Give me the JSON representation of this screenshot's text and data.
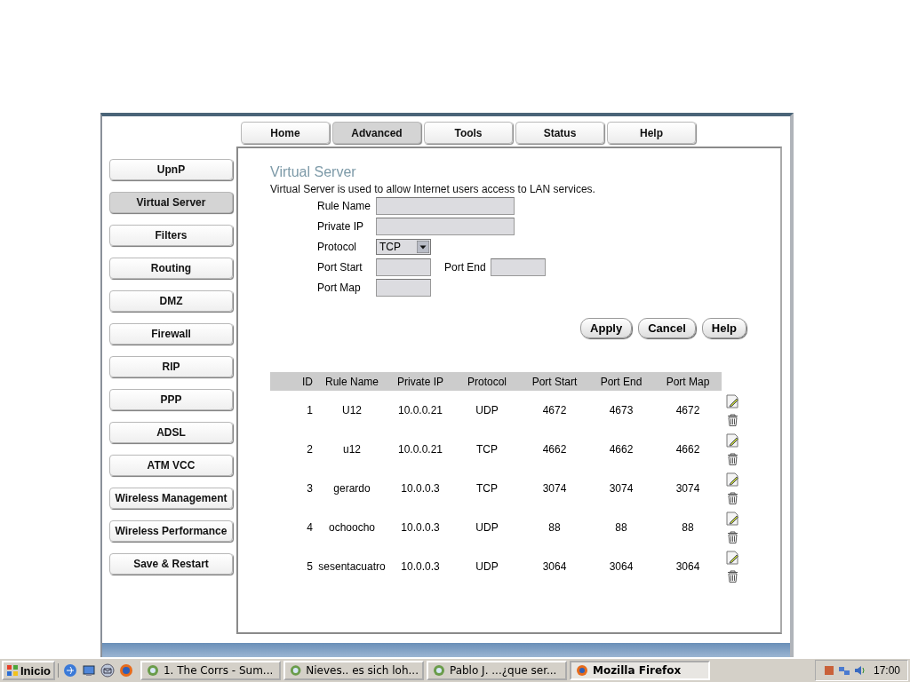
{
  "top_tabs": [
    {
      "label": "Home",
      "selected": false
    },
    {
      "label": "Advanced",
      "selected": true
    },
    {
      "label": "Tools",
      "selected": false
    },
    {
      "label": "Status",
      "selected": false
    },
    {
      "label": "Help",
      "selected": false
    }
  ],
  "sidebar": {
    "items": [
      {
        "label": "UpnP",
        "selected": false
      },
      {
        "label": "Virtual Server",
        "selected": true
      },
      {
        "label": "Filters",
        "selected": false
      },
      {
        "label": "Routing",
        "selected": false
      },
      {
        "label": "DMZ",
        "selected": false
      },
      {
        "label": "Firewall",
        "selected": false
      },
      {
        "label": "RIP",
        "selected": false
      },
      {
        "label": "PPP",
        "selected": false
      },
      {
        "label": "ADSL",
        "selected": false
      },
      {
        "label": "ATM VCC",
        "selected": false
      },
      {
        "label": "Wireless Management",
        "selected": false
      },
      {
        "label": "Wireless Performance",
        "selected": false
      },
      {
        "label": "Save & Restart",
        "selected": false
      }
    ]
  },
  "page": {
    "title": "Virtual Server",
    "description": "Virtual Server is used to allow Internet users access to LAN services."
  },
  "form": {
    "rule_name_label": "Rule Name",
    "private_ip_label": "Private IP",
    "protocol_label": "Protocol",
    "protocol_value": "TCP",
    "port_start_label": "Port Start",
    "port_end_label": "Port End",
    "port_map_label": "Port Map"
  },
  "buttons": [
    "Apply",
    "Cancel",
    "Help"
  ],
  "table": {
    "columns": [
      "ID",
      "Rule Name",
      "Private IP",
      "Protocol",
      "Port Start",
      "Port End",
      "Port Map"
    ],
    "rows": [
      [
        "1",
        "U12",
        "10.0.0.21",
        "UDP",
        "4672",
        "4673",
        "4672"
      ],
      [
        "2",
        "u12",
        "10.0.0.21",
        "TCP",
        "4662",
        "4662",
        "4662"
      ],
      [
        "3",
        "gerardo",
        "10.0.0.3",
        "TCP",
        "3074",
        "3074",
        "3074"
      ],
      [
        "4",
        "ochoocho",
        "10.0.0.3",
        "UDP",
        "88",
        "88",
        "88"
      ],
      [
        "5",
        "sesentacuatro",
        "10.0.0.3",
        "UDP",
        "3064",
        "3064",
        "3064"
      ]
    ]
  },
  "taskbar": {
    "start": "Inicio",
    "tasks": [
      {
        "label": "1. The Corrs - Sum...",
        "selected": false
      },
      {
        "label": "Nieves.. es sich loh...",
        "selected": false
      },
      {
        "label": "Pablo J.  ...¿que ser...",
        "selected": false
      },
      {
        "label": "Mozilla Firefox",
        "selected": true
      }
    ],
    "clock": "17:00"
  }
}
